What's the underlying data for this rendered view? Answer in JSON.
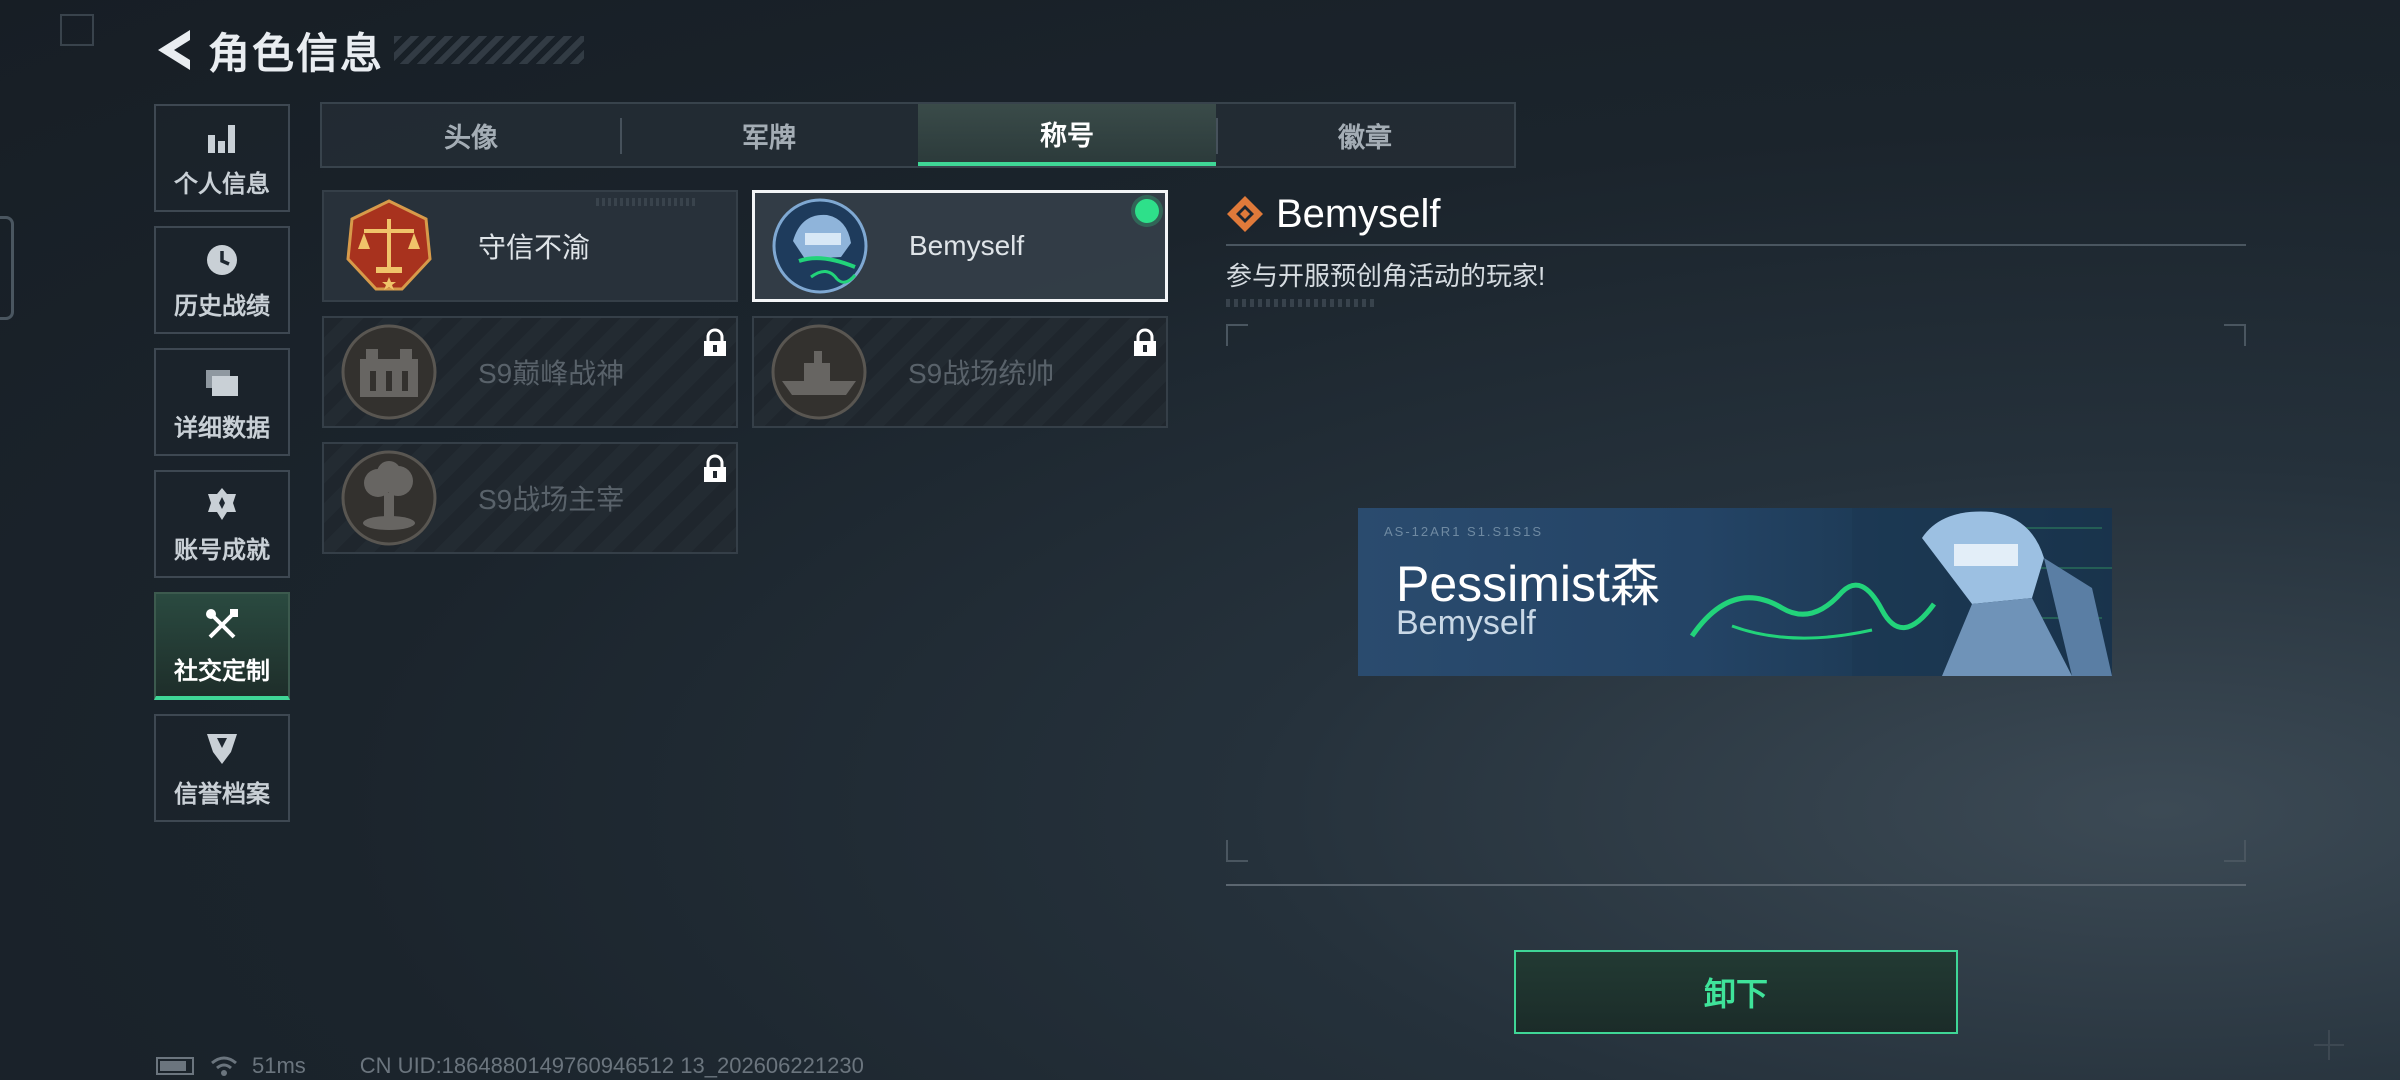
{
  "header": {
    "title": "角色信息"
  },
  "nav": {
    "items": [
      {
        "label": "个人信息",
        "icon": "bar-chart-icon"
      },
      {
        "label": "历史战绩",
        "icon": "history-icon"
      },
      {
        "label": "详细数据",
        "icon": "folder-icon"
      },
      {
        "label": "账号成就",
        "icon": "achievement-icon"
      },
      {
        "label": "社交定制",
        "icon": "tools-icon",
        "active": true
      },
      {
        "label": "信誉档案",
        "icon": "shield-icon"
      }
    ]
  },
  "tabs": [
    {
      "label": "头像"
    },
    {
      "label": "军牌"
    },
    {
      "label": "称号",
      "active": true
    },
    {
      "label": "徽章"
    }
  ],
  "titles": [
    {
      "name": "守信不渝",
      "locked": false,
      "selected": false,
      "emblem": "scales-emblem"
    },
    {
      "name": "Bemyself",
      "locked": false,
      "selected": true,
      "equipped": true,
      "emblem": "soldier-emblem"
    },
    {
      "name": "S9巅峰战神",
      "locked": true,
      "selected": false,
      "emblem": "fortress-emblem"
    },
    {
      "name": "S9战场统帅",
      "locked": true,
      "selected": false,
      "emblem": "ship-emblem"
    },
    {
      "name": "S9战场主宰",
      "locked": true,
      "selected": false,
      "emblem": "explosion-emblem"
    }
  ],
  "detail": {
    "title": "Bemyself",
    "description": "参与开服预创角活动的玩家!"
  },
  "banner": {
    "player_name": "Pessimist森",
    "title": "Bemyself",
    "code": "AS-12AR1  S1.S1S1S"
  },
  "actions": {
    "unequip_label": "卸下"
  },
  "status": {
    "ping": "51ms",
    "uid": "CN UID:1864880149760946512 13_202606221230"
  },
  "colors": {
    "accent": "#3fd696",
    "equipped": "#2ee08a",
    "diamond": "#e07a3a"
  }
}
